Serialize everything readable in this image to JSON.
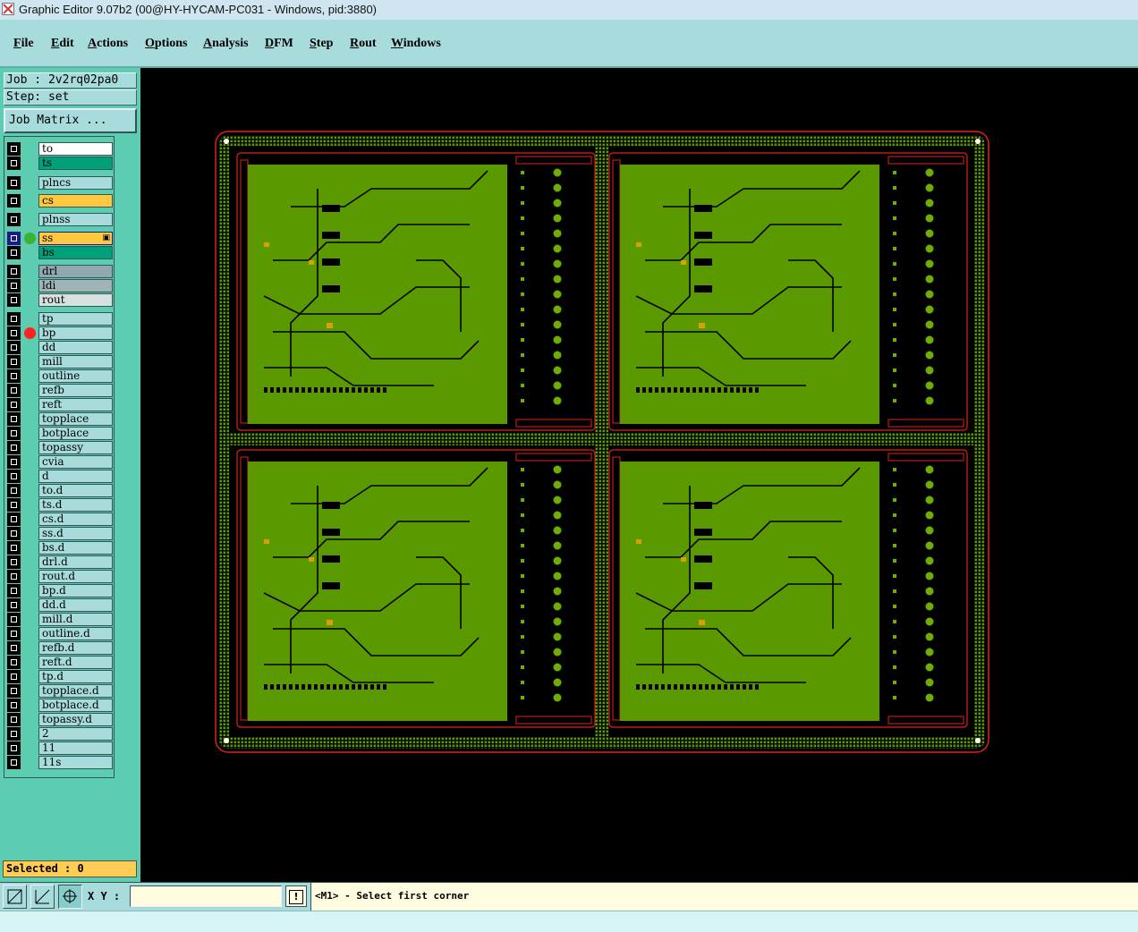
{
  "window": {
    "title": "Graphic Editor 9.07b2 (00@HY-HYCAM-PC031 - Windows, pid:3880)"
  },
  "menu": [
    {
      "pre": "",
      "u": "F",
      "post": "ile"
    },
    {
      "pre": "",
      "u": "E",
      "post": "dit"
    },
    {
      "pre": "",
      "u": "A",
      "post": "ctions"
    },
    {
      "pre": "",
      "u": "O",
      "post": "ptions"
    },
    {
      "pre": "",
      "u": "A",
      "post": "nalysis"
    },
    {
      "pre": "",
      "u": "D",
      "post": "FM"
    },
    {
      "pre": "",
      "u": "S",
      "post": "tep"
    },
    {
      "pre": "",
      "u": "R",
      "post": "out"
    },
    {
      "pre": "",
      "u": "W",
      "post": "indows"
    }
  ],
  "job": {
    "job_label": "Job : 2v2rq02pa0",
    "step_label": "Step: set",
    "matrix_button": "Job Matrix ..."
  },
  "layers": [
    {
      "name": "to",
      "bg": "#ffffff"
    },
    {
      "name": "ts",
      "bg": "#00a07a"
    },
    {
      "name": "plncs",
      "bg": "#a8dcdc"
    },
    {
      "name": "cs",
      "bg": "#ffc840"
    },
    {
      "name": "plnss",
      "bg": "#a8dcdc"
    },
    {
      "name": "ss",
      "bg": "#ffc840",
      "selected": true,
      "dot": "#40b030",
      "mark": "▣"
    },
    {
      "name": "bs",
      "bg": "#00a07a"
    },
    {
      "name": "drl",
      "bg": "#90a8b0"
    },
    {
      "name": "ldi",
      "bg": "#a0b4b8"
    },
    {
      "name": "rout",
      "bg": "#d8e0e0"
    },
    {
      "name": "tp",
      "bg": "#a8dcdc"
    },
    {
      "name": "bp",
      "bg": "#a8dcdc",
      "dot": "#ff2020"
    },
    {
      "name": "dd",
      "bg": "#a8dcdc"
    },
    {
      "name": "mill",
      "bg": "#a8dcdc"
    },
    {
      "name": "outline",
      "bg": "#a8dcdc"
    },
    {
      "name": "refb",
      "bg": "#a8dcdc"
    },
    {
      "name": "reft",
      "bg": "#a8dcdc"
    },
    {
      "name": "topplace",
      "bg": "#a8dcdc"
    },
    {
      "name": "botplace",
      "bg": "#a8dcdc"
    },
    {
      "name": "topassy",
      "bg": "#a8dcdc"
    },
    {
      "name": "cvia",
      "bg": "#a8dcdc"
    },
    {
      "name": "d",
      "bg": "#a8dcdc"
    },
    {
      "name": "to.d",
      "bg": "#a8dcdc"
    },
    {
      "name": "ts.d",
      "bg": "#a8dcdc"
    },
    {
      "name": "cs.d",
      "bg": "#a8dcdc"
    },
    {
      "name": "ss.d",
      "bg": "#a8dcdc"
    },
    {
      "name": "bs.d",
      "bg": "#a8dcdc"
    },
    {
      "name": "drl.d",
      "bg": "#a8dcdc"
    },
    {
      "name": "rout.d",
      "bg": "#a8dcdc"
    },
    {
      "name": "bp.d",
      "bg": "#a8dcdc"
    },
    {
      "name": "dd.d",
      "bg": "#a8dcdc"
    },
    {
      "name": "mill.d",
      "bg": "#a8dcdc"
    },
    {
      "name": "outline.d",
      "bg": "#a8dcdc"
    },
    {
      "name": "refb.d",
      "bg": "#a8dcdc"
    },
    {
      "name": "reft.d",
      "bg": "#a8dcdc"
    },
    {
      "name": "tp.d",
      "bg": "#a8dcdc"
    },
    {
      "name": "topplace.d",
      "bg": "#a8dcdc"
    },
    {
      "name": "botplace.d",
      "bg": "#a8dcdc"
    },
    {
      "name": "topassy.d",
      "bg": "#a8dcdc"
    },
    {
      "name": "2",
      "bg": "#a8dcdc"
    },
    {
      "name": "11",
      "bg": "#a8dcdc"
    },
    {
      "name": "11s",
      "bg": "#a8dcdc"
    }
  ],
  "status": {
    "selected": "Selected : 0"
  },
  "bottom": {
    "xy_label": "X Y :",
    "xy_value": "",
    "prompt": "<M1> - Select first corner"
  },
  "colors": {
    "board_green": "#5a9a00",
    "copper_green": "#6fae00",
    "outline_red": "#e02020",
    "canvas_bg": "#000000"
  }
}
